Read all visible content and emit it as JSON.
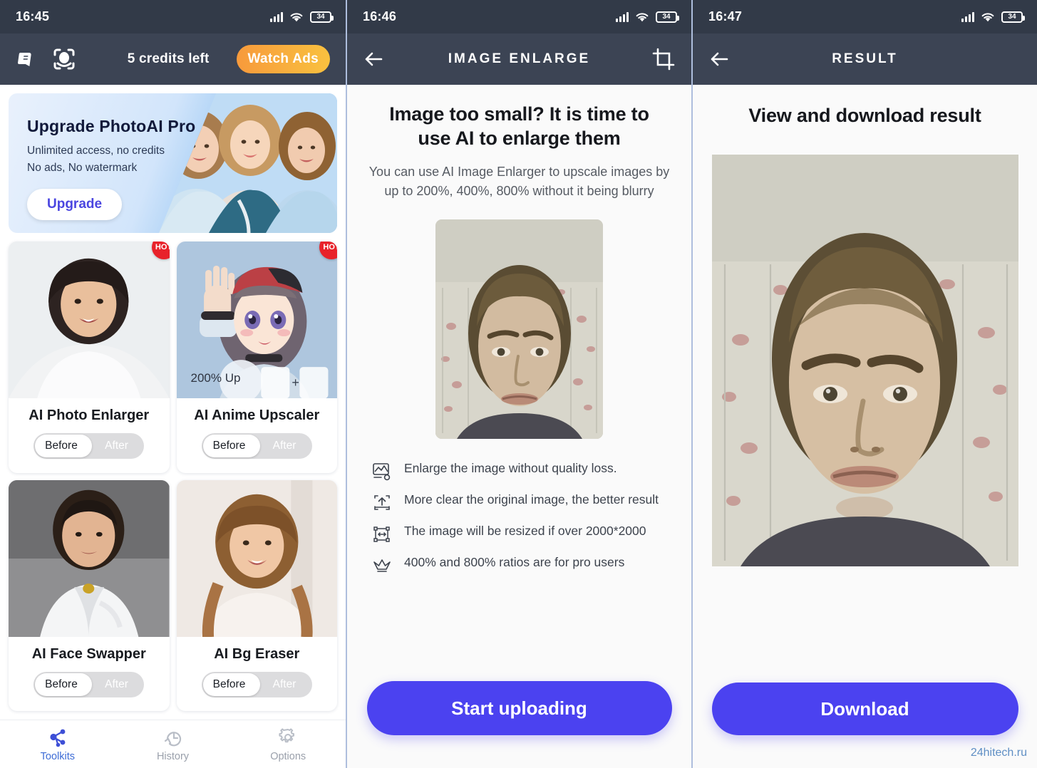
{
  "screens": [
    {
      "id": "home",
      "status": {
        "time": "16:45",
        "battery": "34",
        "signal_icon": "signal-bars-icon",
        "wifi_icon": "wifi-icon",
        "battery_icon": "battery-icon"
      },
      "appbar": {
        "tutorial_icon": "book-icon",
        "face_scan_icon": "face-scan-icon",
        "credits_label": "5 credits left",
        "watch_ads_label": "Watch Ads"
      },
      "promo": {
        "title": "Upgrade PhotoAI Pro",
        "line1": "Unlimited access, no credits",
        "line2": "No ads, No watermark",
        "button": "Upgrade"
      },
      "cards": [
        {
          "name": "AI Photo Enlarger",
          "badge": "HOT",
          "before": "Before",
          "after": "After",
          "overlay": ""
        },
        {
          "name": "AI Anime Upscaler",
          "badge": "HOT",
          "before": "Before",
          "after": "After",
          "overlay": "200% Up"
        },
        {
          "name": "AI Face Swapper",
          "badge": "",
          "before": "Before",
          "after": "After",
          "overlay": ""
        },
        {
          "name": "AI Bg Eraser",
          "badge": "",
          "before": "Before",
          "after": "After",
          "overlay": ""
        }
      ],
      "bottomnav": [
        {
          "label": "Toolkits",
          "icon": "share-nodes-icon",
          "active": true
        },
        {
          "label": "History",
          "icon": "history-clock-icon",
          "active": false
        },
        {
          "label": "Options",
          "icon": "gear-icon",
          "active": false
        }
      ]
    },
    {
      "id": "enlarge",
      "status": {
        "time": "16:46",
        "battery": "34"
      },
      "appbar": {
        "back_icon": "back-arrow-icon",
        "title": "IMAGE ENLARGE",
        "crop_icon": "crop-icon"
      },
      "heading": "Image too small? It is time to use AI to enlarge them",
      "subheading": "You can use AI Image Enlarger to upscale images by up to 200%, 400%, 800% without it being blurry",
      "features": [
        {
          "icon": "image-quality-icon",
          "text": "Enlarge the image without quality loss."
        },
        {
          "icon": "upload-icon",
          "text": "More clear the original image, the better result"
        },
        {
          "icon": "resize-icon",
          "text": "The image will be resized if over 2000*2000"
        },
        {
          "icon": "crown-icon",
          "text": "400% and 800% ratios are for pro users"
        }
      ],
      "cta": "Start uploading"
    },
    {
      "id": "result",
      "status": {
        "time": "16:47",
        "battery": "34"
      },
      "appbar": {
        "back_icon": "back-arrow-icon",
        "title": "RESULT"
      },
      "heading": "View and download result",
      "cta": "Download",
      "watermark": "24hitech.ru"
    }
  ],
  "colors": {
    "statusbar": "#323a48",
    "appbar": "#3c4454",
    "accent_purple": "#4b42f0",
    "watch_ads_start": "#f79a3c",
    "watch_ads_end": "#f9c13f",
    "hot_badge": "#e8222a",
    "nav_active": "#3d6cd6",
    "watermark": "#5e8ec4"
  }
}
